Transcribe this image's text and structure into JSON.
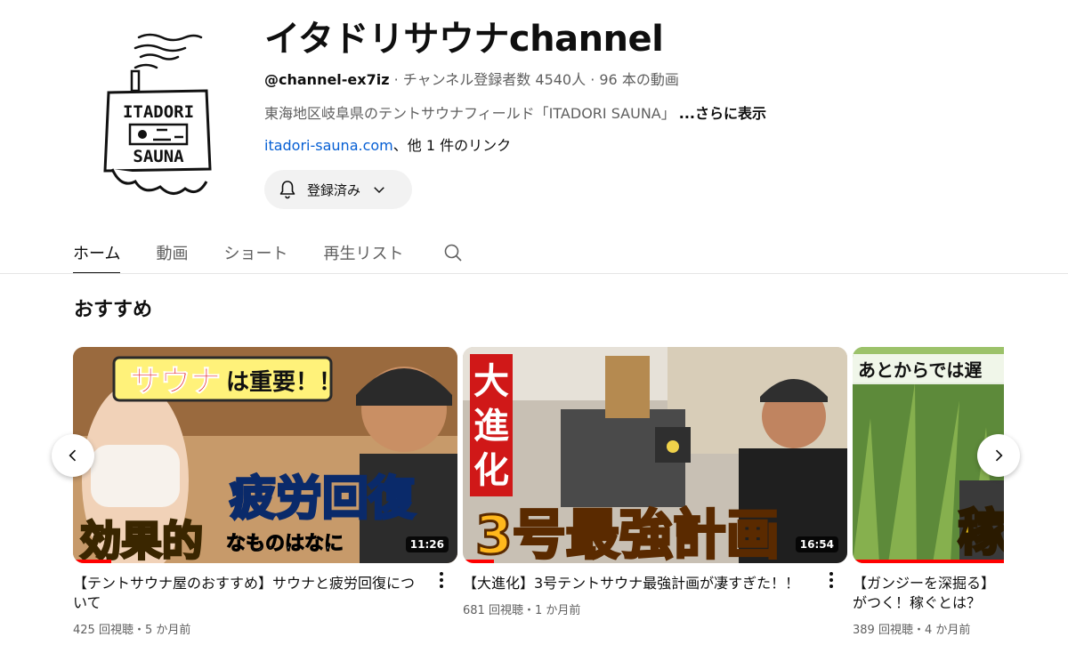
{
  "channel": {
    "title": "イタドリサウナchannel",
    "handle": "@channel-ex7iz",
    "meta": " · チャンネル登録者数 4540人 · 96 本の動画",
    "description": "東海地区岐阜県のテントサウナフィールド「ITADORI SAUNA」",
    "more_label": "...さらに表示",
    "link_text": "itadori-sauna.com",
    "link_suffix": "、他 1 件のリンク",
    "subscribe_label": "登録済み",
    "logo_text_top": "ITADORI",
    "logo_text_bottom": "SAUNA"
  },
  "tabs": [
    {
      "label": "ホーム",
      "active": true
    },
    {
      "label": "動画"
    },
    {
      "label": "ショート"
    },
    {
      "label": "再生リスト"
    }
  ],
  "section": {
    "title": "おすすめ"
  },
  "videos": [
    {
      "title": "【テントサウナ屋のおすすめ】サウナと疲労回復について",
      "meta": "425 回視聴・5 か月前",
      "duration": "11:26",
      "watched": 0.1,
      "thumb_text": {
        "bubble_a": "サウナ",
        "bubble_b": "は重要！！",
        "big": "疲労回復",
        "left": "効果的",
        "right": "なものはなに"
      }
    },
    {
      "title": "【大進化】3号テントサウナ最強計画が凄すぎた！！",
      "meta": "681 回視聴・1 か月前",
      "duration": "16:54",
      "watched": 0.08,
      "thumb_text": {
        "v1": "大",
        "v2": "進",
        "v3": "化",
        "big": "3号最強計画"
      }
    },
    {
      "title": "【ガンジーを深掘る】がつく！稼ぐとは？",
      "meta": "389 回視聴・4 か月前",
      "watched": 1.0,
      "thumb_text": {
        "top": "あとからでは遅",
        "big": "稼"
      }
    }
  ],
  "colors": {
    "accent_red": "#ff0000",
    "link_blue": "#065fd4",
    "secondary_text": "#606060"
  }
}
